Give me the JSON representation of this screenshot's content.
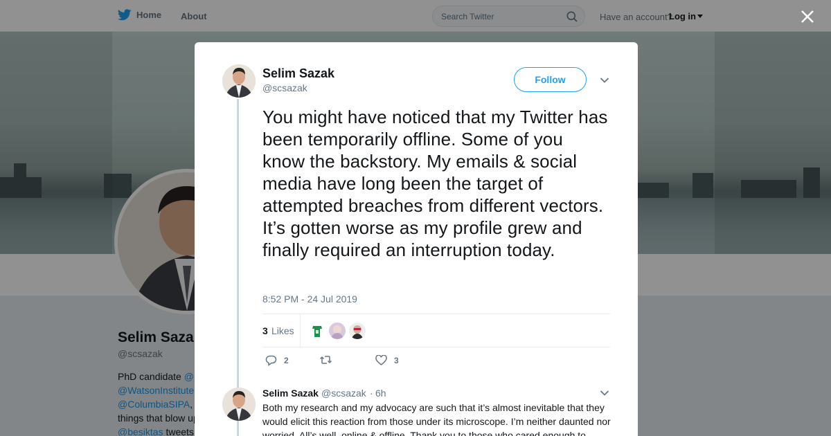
{
  "nav": {
    "home_label": "Home",
    "about_label": "About",
    "search_placeholder": "Search Twitter",
    "have_account": "Have an account?",
    "login_label": "Log in"
  },
  "profile": {
    "name": "Selim Saza",
    "handle": "@scsazak",
    "bio_lines": [
      {
        "pre": "PhD candidate ",
        "link": "@"
      },
      {
        "pre": "",
        "link": "@WatsonInstitute"
      },
      {
        "pre": "",
        "link": "@ColumbiaSIPA",
        "post": ","
      },
      {
        "pre": "things that blow up",
        "link": ""
      },
      {
        "pre": "",
        "link": "@besiktas",
        "post": " tweets"
      }
    ]
  },
  "tweet": {
    "author_name": "Selim Sazak",
    "author_handle": "@scsazak",
    "follow_label": "Follow",
    "text": "You might have noticed that my Twitter has been temporarily offline. Some of you know the backstory. My emails & social media have long been the target of attempted breaches from different vectors. It’s gotten worse as my profile grew and finally required an interruption today.",
    "timestamp": "8:52 PM - 24 Jul 2019",
    "likes_count": "3",
    "likes_label": "Likes",
    "reply_count": "2",
    "retweet_count": "",
    "like_count": "3"
  },
  "reply": {
    "author_name": "Selim Sazak",
    "author_handle": "@scsazak",
    "separator": "·",
    "time": "6h",
    "text": "Both my research and my advocacy are such that it’s almost inevitable that they would elicit this reaction from those under its microscope. I’m neither daunted nor worried. All’s well, online & offline. Thank you to those who cared enough to"
  },
  "colors": {
    "twitter_blue": "#1da1f2",
    "text_primary": "#14171a",
    "text_secondary": "#657786",
    "overlay": "rgba(0,0,0,0.43)"
  },
  "icons": [
    "twitter-bird-icon",
    "search-icon",
    "close-icon",
    "chevron-down-icon",
    "reply-icon",
    "retweet-icon",
    "heart-icon"
  ]
}
